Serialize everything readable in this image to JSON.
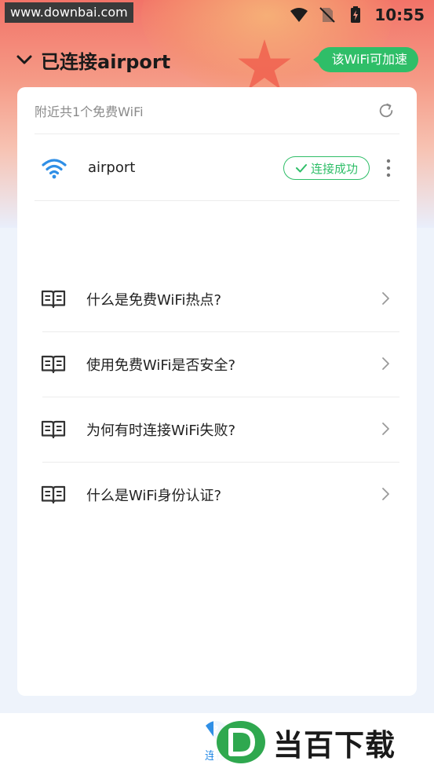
{
  "status_bar": {
    "watermark": "www.downbai.com",
    "time": "10:55"
  },
  "header": {
    "title": "已连接airport",
    "speed_badge": "该WiFi可加速"
  },
  "card": {
    "nearby_text": "附近共1个免费WiFi",
    "network": {
      "name": "airport",
      "status": "连接成功"
    },
    "faq": [
      {
        "text": "什么是免费WiFi热点?"
      },
      {
        "text": "使用免费WiFi是否安全?"
      },
      {
        "text": "为何有时连接WiFi失败?"
      },
      {
        "text": "什么是WiFi身份认证?"
      }
    ]
  },
  "bottom_nav": {
    "tab_label": "连接"
  },
  "logo_watermark": {
    "text": "当百下载"
  },
  "colors": {
    "accent_green": "#2fbe68",
    "accent_blue": "#2f8fe6",
    "header_red": "#f27368"
  }
}
